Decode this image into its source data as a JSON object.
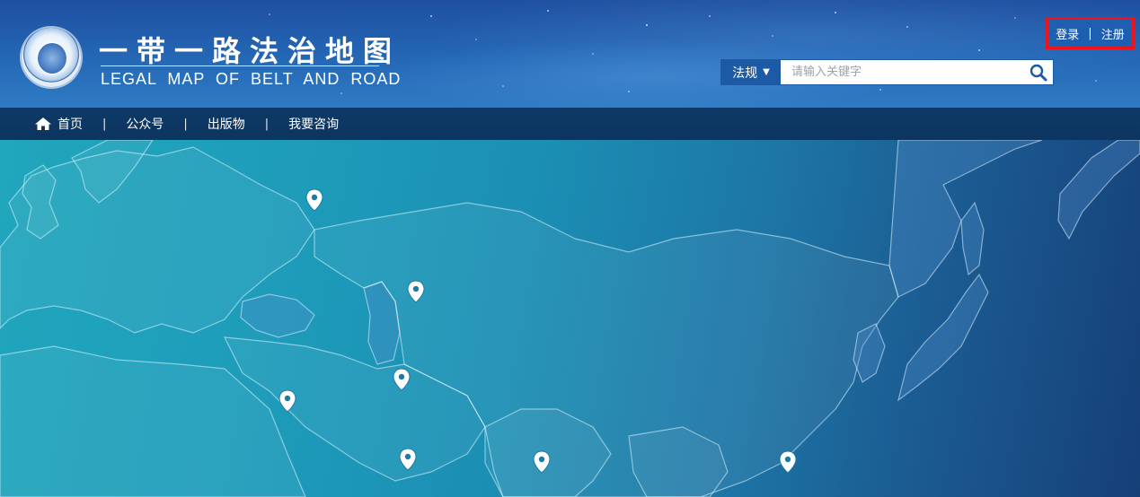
{
  "header": {
    "title": "一带一路法治地图",
    "subtitle": "LEGAL MAP OF BELT AND ROAD",
    "logo_icon": "emblem-logo-icon",
    "auth": {
      "login": "登录",
      "separator": "|",
      "register": "注册",
      "highlight_color": "#f0141a"
    },
    "search": {
      "category": "法规",
      "placeholder": "请输入关键字",
      "button_icon": "search-icon"
    }
  },
  "nav": {
    "items": [
      {
        "label": "首页",
        "icon": "home-icon"
      },
      {
        "label": "公众号"
      },
      {
        "label": "出版物"
      },
      {
        "label": "我要咨询"
      }
    ],
    "separator": "|"
  },
  "map": {
    "pins": [
      {
        "name": "map-pin-russia"
      },
      {
        "name": "map-pin-kazakhstan"
      },
      {
        "name": "map-pin-iran"
      },
      {
        "name": "map-pin-israel"
      },
      {
        "name": "map-pin-uae"
      },
      {
        "name": "map-pin-india"
      },
      {
        "name": "map-pin-hong-kong"
      }
    ]
  },
  "colors": {
    "header_blue": "#2468b6",
    "nav_blue": "#0f3966",
    "map_teal": "#1e9cba",
    "map_navy": "#163f78"
  }
}
